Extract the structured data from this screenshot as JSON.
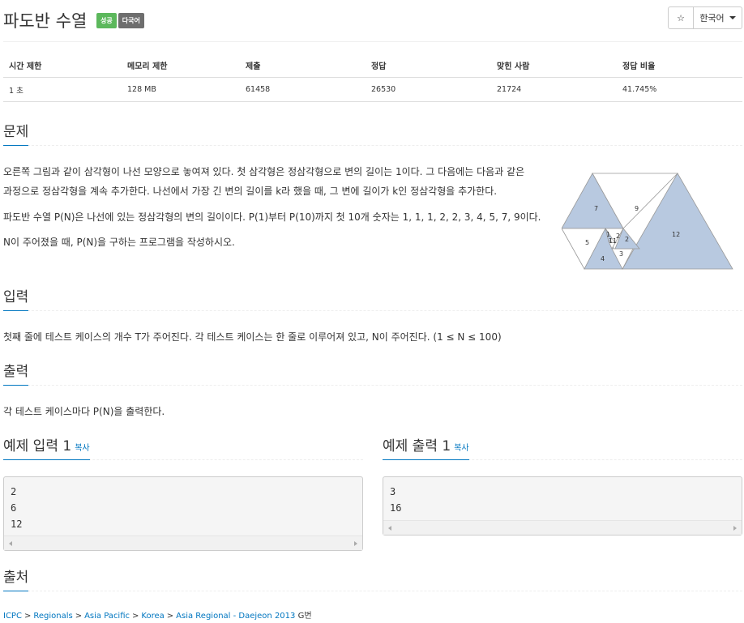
{
  "header": {
    "title": "파도반 수열",
    "badges": [
      "성공",
      "다국어"
    ],
    "star": "☆",
    "language": "한국어"
  },
  "stats": {
    "headers": [
      "시간 제한",
      "메모리 제한",
      "제출",
      "정답",
      "맞힌 사람",
      "정답 비율"
    ],
    "values": [
      "1 초",
      "128 MB",
      "61458",
      "26530",
      "21724",
      "41.745%"
    ]
  },
  "problem": {
    "heading": "문제",
    "lines": [
      "오른쪽 그림과 같이 삼각형이 나선 모양으로 놓여져 있다. 첫 삼각형은 정삼각형으로 변의 길이는 1이다. 그 다음에는 다음과 같은",
      "과정으로 정삼각형을 계속 추가한다. 나선에서 가장 긴 변의 길이를 k라 했을 때, 그 변에 길이가 k인 정삼각형을 추가한다.",
      "파도반 수열 P(N)은 나선에 있는 정삼각형의 변의 길이이다. P(1)부터 P(10)까지 첫 10개 숫자는 1, 1, 1, 2, 2, 3, 4, 5, 7, 9이다.",
      "N이 주어졌을 때, P(N)을 구하는 프로그램을 작성하시오."
    ],
    "figure_labels": [
      "7",
      "9",
      "5",
      "1",
      "1",
      "1",
      "2",
      "2",
      "3",
      "4",
      "12"
    ],
    "figure_colors": {
      "fill": "#b8c9e0",
      "stroke": "#999999"
    }
  },
  "input": {
    "heading": "입력",
    "text": "첫째 줄에 테스트 케이스의 개수 T가 주어진다. 각 테스트 케이스는 한 줄로 이루어져 있고, N이 주어진다. (1 ≤ N ≤ 100)"
  },
  "output": {
    "heading": "출력",
    "text": "각 테스트 케이스마다 P(N)을 출력한다."
  },
  "sample_input": {
    "heading": "예제 입력 1",
    "copy": "복사",
    "lines": [
      "2",
      "6",
      "12"
    ]
  },
  "sample_output": {
    "heading": "예제 출력 1",
    "copy": "복사",
    "lines": [
      "3",
      "16"
    ]
  },
  "source": {
    "heading": "출처",
    "crumbs": [
      "ICPC",
      "Regionals",
      "Asia Pacific",
      "Korea",
      "Asia Regional - Daejeon 2013"
    ],
    "separator": ">",
    "suffix": "G번"
  }
}
